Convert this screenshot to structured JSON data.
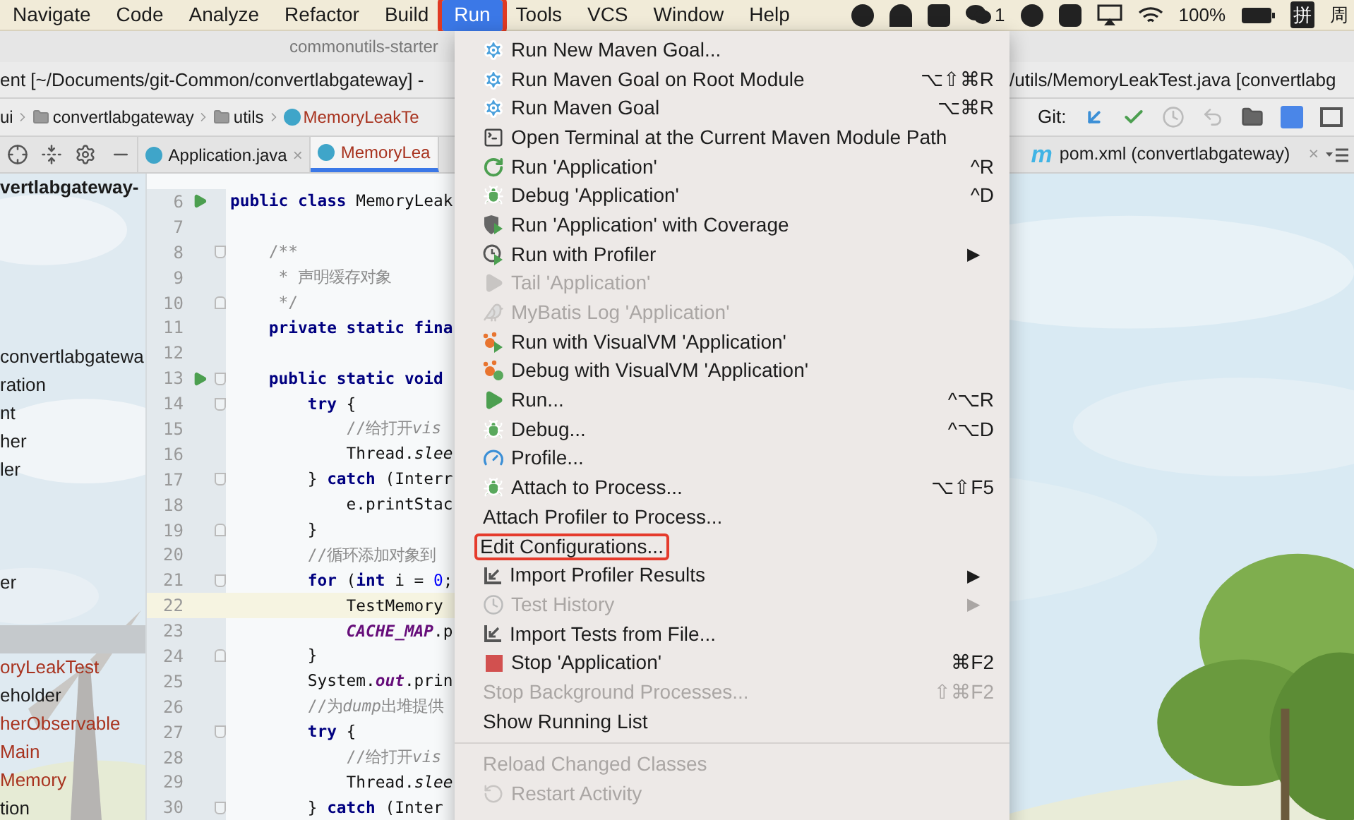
{
  "menubar": {
    "items": [
      {
        "label": "Navigate",
        "selected": false,
        "marked": false
      },
      {
        "label": "Code",
        "selected": false,
        "marked": false
      },
      {
        "label": "Analyze",
        "selected": false,
        "marked": false
      },
      {
        "label": "Refactor",
        "selected": false,
        "marked": false
      },
      {
        "label": "Build",
        "selected": false,
        "marked": false
      },
      {
        "label": "Run",
        "selected": true,
        "marked": true
      },
      {
        "label": "Tools",
        "selected": false,
        "marked": false
      },
      {
        "label": "VCS",
        "selected": false,
        "marked": false
      },
      {
        "label": "Window",
        "selected": false,
        "marked": false
      },
      {
        "label": "Help",
        "selected": false,
        "marked": false
      }
    ],
    "chat_count": "1",
    "battery": "100%",
    "input_method": "拼",
    "clock": "周"
  },
  "window": {
    "title": "commonutils-starter",
    "path_left": "ent [~/Documents/git-Common/convertlabgateway] -",
    "path_right": "/utils/MemoryLeakTest.java [convertlabg"
  },
  "breadcrumbs": [
    {
      "label": "ui",
      "kind": "plain"
    },
    {
      "label": "convertlabgateway",
      "kind": "folder"
    },
    {
      "label": "utils",
      "kind": "folder"
    },
    {
      "label": "MemoryLeakTe",
      "kind": "class"
    }
  ],
  "git": {
    "label": "Git:"
  },
  "tabs": [
    {
      "label": "Application.java",
      "selected": false,
      "close": "×",
      "kind": "java"
    },
    {
      "label": "MemoryLea",
      "selected": true,
      "kind": "java"
    }
  ],
  "right_tab": {
    "badge": "m",
    "label": "pom.xml (convertlabgateway)",
    "close": "×"
  },
  "project_tree": [
    {
      "label": "vertlabgateway-",
      "kind": "root",
      "color": "#1a1a1a",
      "selected": false
    },
    {
      "label": "convertlabgatewa",
      "kind": "node",
      "color": "#1a1a1a",
      "selected": false
    },
    {
      "label": "ration",
      "kind": "node",
      "color": "#1a1a1a",
      "selected": false
    },
    {
      "label": "nt",
      "kind": "node",
      "color": "#1a1a1a",
      "selected": false
    },
    {
      "label": "her",
      "kind": "node",
      "color": "#1a1a1a",
      "selected": false
    },
    {
      "label": "ler",
      "kind": "node",
      "color": "#1a1a1a",
      "selected": false
    },
    {
      "label": "er",
      "kind": "node",
      "color": "#1a1a1a",
      "selected": false
    },
    {
      "kind": "node",
      "selected": true
    },
    {
      "label": "oryLeakTest",
      "kind": "node",
      "color": "#a8331f",
      "selected": false
    },
    {
      "label": "eholder",
      "kind": "node",
      "color": "#1a1a1a",
      "selected": false
    },
    {
      "label": "herObservable",
      "kind": "node",
      "color": "#a8331f",
      "selected": false
    },
    {
      "label": "Main",
      "kind": "node",
      "color": "#a8331f",
      "selected": false
    },
    {
      "label": "Memory",
      "kind": "node",
      "color": "#a8331f",
      "selected": false
    },
    {
      "label": "tion",
      "kind": "node",
      "color": "#1a1a1a",
      "selected": false
    }
  ],
  "code": [
    {
      "number": "6",
      "run": true,
      "fold_start": false,
      "fold_end": false,
      "current": false,
      "tokens": [
        {
          "kind": "kw",
          "text": "public class"
        },
        {
          "kind": "plain",
          "text": " MemoryLeak"
        }
      ]
    },
    {
      "number": "7",
      "run": false,
      "fold_start": false,
      "fold_end": false,
      "current": false
    },
    {
      "number": "8",
      "run": false,
      "fold_start": true,
      "fold_end": false,
      "current": false,
      "tokens": [
        {
          "kind": "comment",
          "text": "    /**"
        }
      ]
    },
    {
      "number": "9",
      "run": false,
      "fold_start": false,
      "fold_end": false,
      "current": false,
      "tokens": [
        {
          "kind": "comment",
          "text": "     * 声明缓存对象"
        }
      ]
    },
    {
      "number": "10",
      "run": false,
      "fold_start": false,
      "fold_end": true,
      "current": false,
      "tokens": [
        {
          "kind": "comment",
          "text": "     */"
        }
      ]
    },
    {
      "number": "11",
      "run": false,
      "fold_start": false,
      "fold_end": false,
      "current": false,
      "tokens": [
        {
          "kind": "kw",
          "text": "    private static fina"
        }
      ]
    },
    {
      "number": "12",
      "run": false,
      "fold_start": false,
      "fold_end": false,
      "current": false
    },
    {
      "number": "13",
      "run": true,
      "fold_start": true,
      "fold_end": false,
      "current": false,
      "tokens": [
        {
          "kind": "kw",
          "text": "    public static void"
        }
      ]
    },
    {
      "number": "14",
      "run": false,
      "fold_start": true,
      "fold_end": false,
      "current": false,
      "tokens": [
        {
          "kind": "kw",
          "text": "        try"
        },
        {
          "kind": "plain",
          "text": " {"
        }
      ]
    },
    {
      "number": "15",
      "run": false,
      "fold_start": false,
      "fold_end": false,
      "current": false,
      "tokens": [
        {
          "kind": "comment",
          "text": "            //给打开"
        },
        {
          "kind": "comment_italic",
          "text": "vis"
        }
      ]
    },
    {
      "number": "16",
      "run": false,
      "fold_start": false,
      "fold_end": false,
      "current": false,
      "tokens": [
        {
          "kind": "plain",
          "text": "            Thread."
        },
        {
          "kind": "italic",
          "text": "slee"
        }
      ]
    },
    {
      "number": "17",
      "run": false,
      "fold_start": true,
      "fold_end": false,
      "current": false,
      "tokens": [
        {
          "kind": "plain",
          "text": "        } "
        },
        {
          "kind": "kw",
          "text": "catch"
        },
        {
          "kind": "plain",
          "text": " (Interr"
        }
      ]
    },
    {
      "number": "18",
      "run": false,
      "fold_start": false,
      "fold_end": false,
      "current": false,
      "tokens": [
        {
          "kind": "plain",
          "text": "            e.printStac"
        }
      ]
    },
    {
      "number": "19",
      "run": false,
      "fold_start": false,
      "fold_end": true,
      "current": false,
      "tokens": [
        {
          "kind": "plain",
          "text": "        }"
        }
      ]
    },
    {
      "number": "20",
      "run": false,
      "fold_start": false,
      "fold_end": false,
      "current": false,
      "tokens": [
        {
          "kind": "comment",
          "text": "        //循环添加对象到"
        }
      ]
    },
    {
      "number": "21",
      "run": false,
      "fold_start": true,
      "fold_end": false,
      "current": false,
      "tokens": [
        {
          "kind": "kw",
          "text": "        for"
        },
        {
          "kind": "plain",
          "text": " ("
        },
        {
          "kind": "kw",
          "text": "int"
        },
        {
          "kind": "plain",
          "text": " i = "
        },
        {
          "kind": "num",
          "text": "0"
        },
        {
          "kind": "plain",
          "text": ";"
        }
      ]
    },
    {
      "number": "22",
      "run": false,
      "fold_start": false,
      "fold_end": false,
      "current": true,
      "tokens": [
        {
          "kind": "plain",
          "text": "            TestMemory"
        }
      ]
    },
    {
      "number": "23",
      "run": false,
      "fold_start": false,
      "fold_end": false,
      "current": false,
      "tokens": [
        {
          "kind": "static",
          "text": "            CACHE_MAP"
        },
        {
          "kind": "plain",
          "text": ".p"
        }
      ]
    },
    {
      "number": "24",
      "run": false,
      "fold_start": false,
      "fold_end": true,
      "current": false,
      "tokens": [
        {
          "kind": "plain",
          "text": "        }"
        }
      ]
    },
    {
      "number": "25",
      "run": false,
      "fold_start": false,
      "fold_end": false,
      "current": false,
      "tokens": [
        {
          "kind": "plain",
          "text": "        System."
        },
        {
          "kind": "static",
          "text": "out"
        },
        {
          "kind": "plain",
          "text": ".prin"
        }
      ]
    },
    {
      "number": "26",
      "run": false,
      "fold_start": false,
      "fold_end": false,
      "current": false,
      "tokens": [
        {
          "kind": "comment",
          "text": "        //为"
        },
        {
          "kind": "comment_italic",
          "text": "dump"
        },
        {
          "kind": "comment",
          "text": "出堆提供"
        }
      ]
    },
    {
      "number": "27",
      "run": false,
      "fold_start": true,
      "fold_end": false,
      "current": false,
      "tokens": [
        {
          "kind": "kw",
          "text": "        try"
        },
        {
          "kind": "plain",
          "text": " {"
        }
      ]
    },
    {
      "number": "28",
      "run": false,
      "fold_start": false,
      "fold_end": false,
      "current": false,
      "tokens": [
        {
          "kind": "comment",
          "text": "            //给打开"
        },
        {
          "kind": "comment_italic",
          "text": "vis"
        }
      ]
    },
    {
      "number": "29",
      "run": false,
      "fold_start": false,
      "fold_end": false,
      "current": false,
      "tokens": [
        {
          "kind": "plain",
          "text": "            Thread."
        },
        {
          "kind": "italic",
          "text": "slee"
        }
      ]
    },
    {
      "number": "30",
      "run": false,
      "fold_start": true,
      "fold_end": false,
      "current": false,
      "tokens": [
        {
          "kind": "plain",
          "text": "        } "
        },
        {
          "kind": "kw",
          "text": "catch"
        },
        {
          "kind": "plain",
          "text": " (Inter"
        }
      ]
    }
  ],
  "run_menu": {
    "items": [
      {
        "kind": "item",
        "label": "Run New Maven Goal...",
        "disabled": false,
        "marked": false
      },
      {
        "kind": "item",
        "label": "Run Maven Goal on Root Module",
        "shortcut": "⌥⇧⌘R",
        "disabled": false,
        "marked": false
      },
      {
        "kind": "item",
        "label": "Run Maven Goal",
        "shortcut": "⌥⌘R",
        "disabled": false,
        "marked": false
      },
      {
        "kind": "item",
        "label": "Open Terminal at the Current Maven Module Path",
        "disabled": false,
        "marked": false
      },
      {
        "kind": "item",
        "label": "Run 'Application'",
        "shortcut": "^R",
        "disabled": false,
        "marked": false
      },
      {
        "kind": "item",
        "label": "Debug 'Application'",
        "shortcut": "^D",
        "disabled": false,
        "marked": false
      },
      {
        "kind": "item",
        "label": "Run 'Application' with Coverage",
        "disabled": false,
        "marked": false
      },
      {
        "kind": "item",
        "label": "Run with Profiler",
        "submenu": "▶",
        "disabled": false,
        "marked": false
      },
      {
        "kind": "item",
        "label": "Tail 'Application'",
        "disabled": true,
        "marked": false
      },
      {
        "kind": "item",
        "label": "MyBatis Log 'Application'",
        "disabled": true,
        "marked": false
      },
      {
        "kind": "item",
        "label": "Run with VisualVM 'Application'",
        "disabled": false,
        "marked": false
      },
      {
        "kind": "item",
        "label": "Debug with VisualVM 'Application'",
        "disabled": false,
        "marked": false
      },
      {
        "kind": "item",
        "label": "Run...",
        "shortcut": "^⌥R",
        "disabled": false,
        "marked": false
      },
      {
        "kind": "item",
        "label": "Debug...",
        "shortcut": "^⌥D",
        "disabled": false,
        "marked": false
      },
      {
        "kind": "item",
        "label": "Profile...",
        "disabled": false,
        "marked": false
      },
      {
        "kind": "item",
        "label": "Attach to Process...",
        "shortcut": "⌥⇧F5",
        "disabled": false,
        "marked": false
      },
      {
        "kind": "item",
        "label": "Attach Profiler to Process...",
        "disabled": false,
        "marked": false
      },
      {
        "kind": "item",
        "label": "Edit Configurations...",
        "disabled": false,
        "marked": true
      },
      {
        "kind": "item",
        "label": "Import Profiler Results",
        "submenu": "▶",
        "disabled": false,
        "marked": false
      },
      {
        "kind": "item",
        "label": "Test History",
        "submenu": "▶",
        "disabled": true,
        "marked": false
      },
      {
        "kind": "item",
        "label": "Import Tests from File...",
        "disabled": false,
        "marked": false
      },
      {
        "kind": "item",
        "label": "Stop 'Application'",
        "shortcut": "⌘F2",
        "disabled": false,
        "marked": false
      },
      {
        "kind": "item",
        "label": "Stop Background Processes...",
        "shortcut": "⇧⌘F2",
        "disabled": true,
        "marked": false
      },
      {
        "kind": "item",
        "label": "Show Running List",
        "disabled": false,
        "marked": false
      },
      {
        "kind": "separator"
      },
      {
        "kind": "item",
        "label": "Reload Changed Classes",
        "disabled": true,
        "marked": false
      },
      {
        "kind": "item",
        "label": "Restart Activity",
        "disabled": true,
        "marked": false
      }
    ]
  }
}
